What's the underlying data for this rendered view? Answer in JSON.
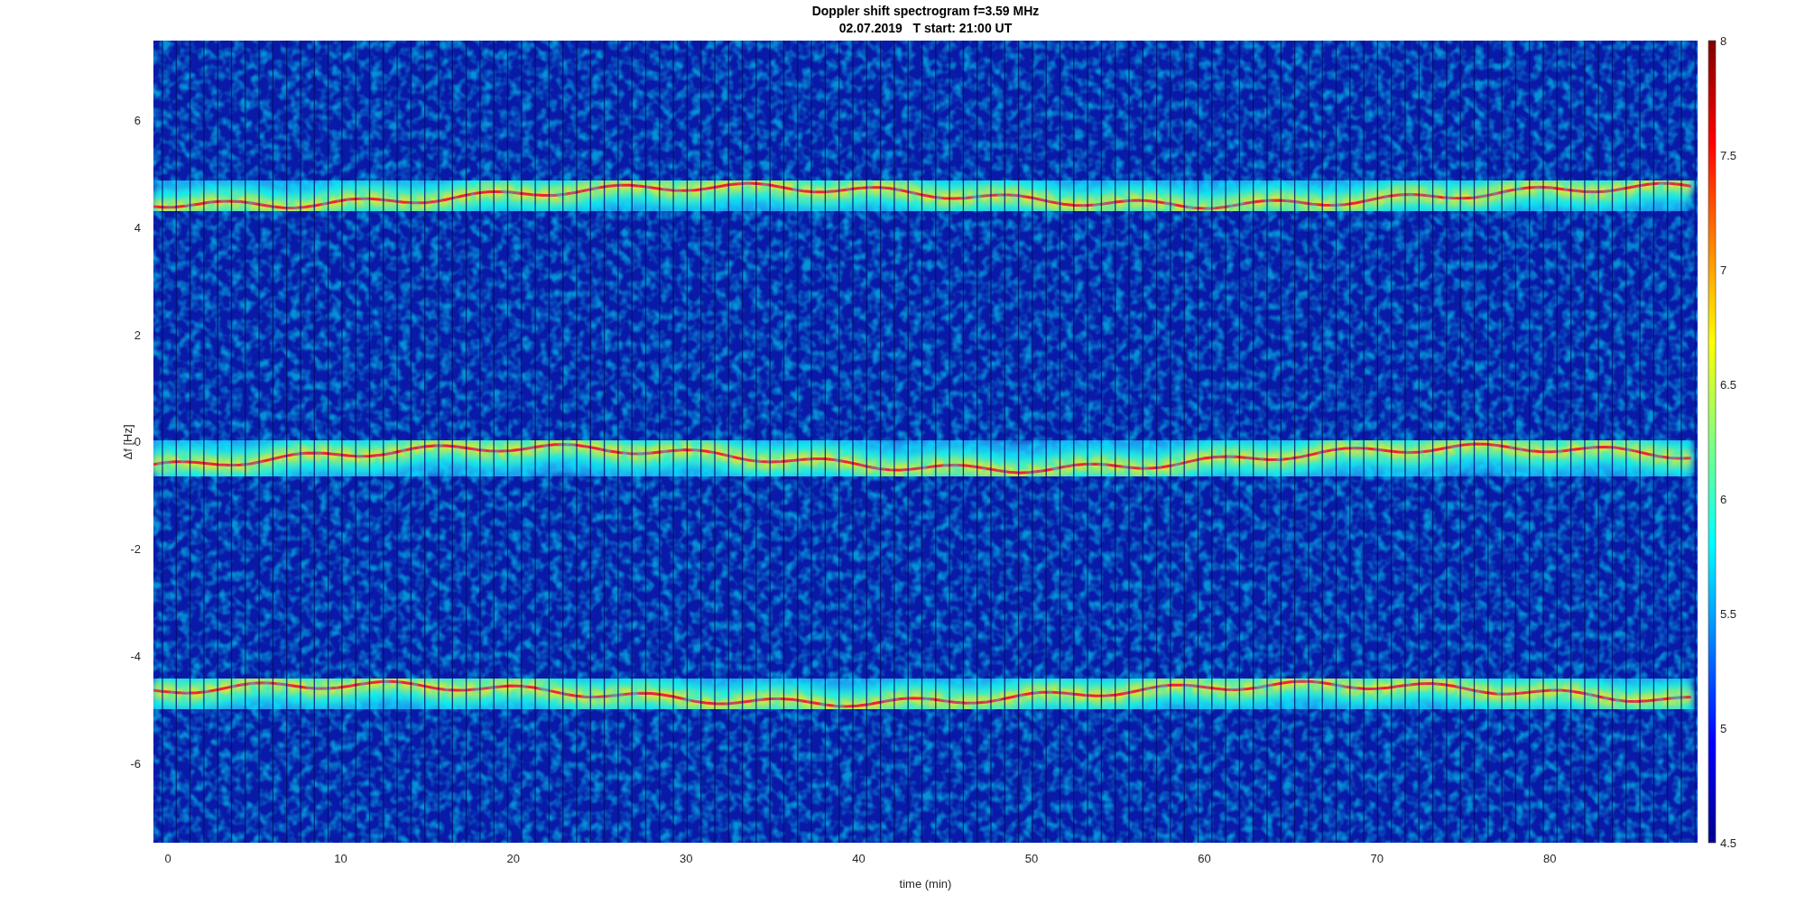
{
  "title": [
    "Doppler shift spectrogram f=3.59 MHz",
    "02.07.2019   T start: 21:00 UT"
  ],
  "xlabel": "time (min)",
  "ylabel": "Δf [Hz]",
  "xticks": [
    "0",
    "10",
    "20",
    "30",
    "40",
    "50",
    "60",
    "70",
    "80"
  ],
  "yticks": [
    "6",
    "4",
    "2",
    "0",
    "-2",
    "-4",
    "-6"
  ],
  "colorbar_ticks": [
    "8",
    "7.5",
    "7",
    "6.5",
    "6",
    "5.5",
    "5",
    "4.5"
  ]
}
